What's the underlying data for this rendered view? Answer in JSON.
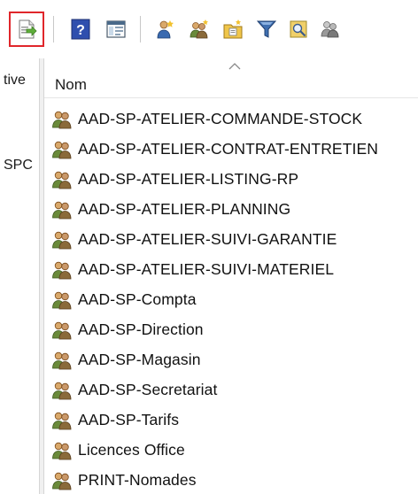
{
  "toolbar": {
    "buttons": [
      {
        "name": "export-list-icon"
      },
      {
        "name": "help-icon"
      },
      {
        "name": "console-view-icon"
      },
      {
        "name": "new-user-icon"
      },
      {
        "name": "new-group-icon"
      },
      {
        "name": "new-ou-icon"
      },
      {
        "name": "filter-icon"
      },
      {
        "name": "find-icon"
      },
      {
        "name": "add-to-group-icon"
      }
    ]
  },
  "left_pane": {
    "fragments": [
      "tive",
      "SPC"
    ]
  },
  "list": {
    "column_header": "Nom",
    "items": [
      "AAD-SP-ATELIER-COMMANDE-STOCK",
      "AAD-SP-ATELIER-CONTRAT-ENTRETIEN",
      "AAD-SP-ATELIER-LISTING-RP",
      "AAD-SP-ATELIER-PLANNING",
      "AAD-SP-ATELIER-SUIVI-GARANTIE",
      "AAD-SP-ATELIER-SUIVI-MATERIEL",
      "AAD-SP-Compta",
      "AAD-SP-Direction",
      "AAD-SP-Magasin",
      "AAD-SP-Secretariat",
      "AAD-SP-Tarifs",
      "Licences Office",
      "PRINT-Nomades"
    ]
  },
  "colors": {
    "highlight": "#e0262b",
    "group_icon_green": "#6a8a3a",
    "group_icon_brown": "#8a6a3a"
  }
}
